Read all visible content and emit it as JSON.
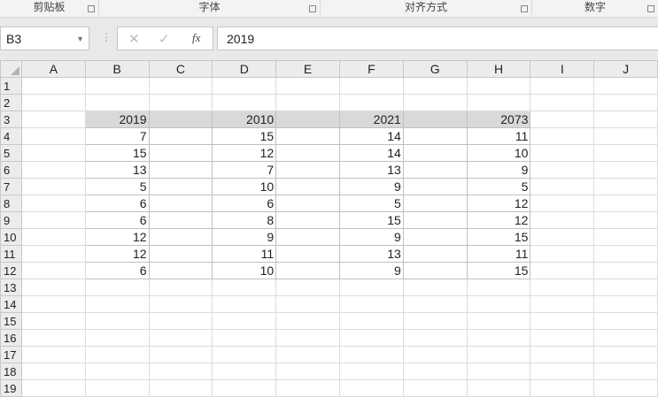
{
  "ribbon": {
    "groups": [
      "剪贴板",
      "字体",
      "对齐方式",
      "数字"
    ]
  },
  "formula_bar": {
    "name_box": "B3",
    "cancel_icon": "✕",
    "enter_icon": "✓",
    "fx_label": "fx",
    "value": "2019"
  },
  "columns": [
    "A",
    "B",
    "C",
    "D",
    "E",
    "F",
    "G",
    "H",
    "I",
    "J"
  ],
  "rows": [
    1,
    2,
    3,
    4,
    5,
    6,
    7,
    8,
    9,
    10,
    11,
    12,
    13,
    14,
    15,
    16,
    17,
    18,
    19
  ],
  "selected_range": "B3:H3",
  "table": {
    "headers": {
      "B": "2019",
      "D": "2010",
      "F": "2021",
      "H": "2073"
    },
    "B": [
      7,
      15,
      13,
      5,
      6,
      6,
      12,
      12,
      6
    ],
    "D": [
      15,
      12,
      7,
      10,
      6,
      8,
      9,
      11,
      10
    ],
    "F": [
      14,
      14,
      13,
      9,
      5,
      15,
      9,
      13,
      9
    ],
    "H": [
      11,
      10,
      9,
      5,
      12,
      12,
      15,
      11,
      15
    ]
  }
}
